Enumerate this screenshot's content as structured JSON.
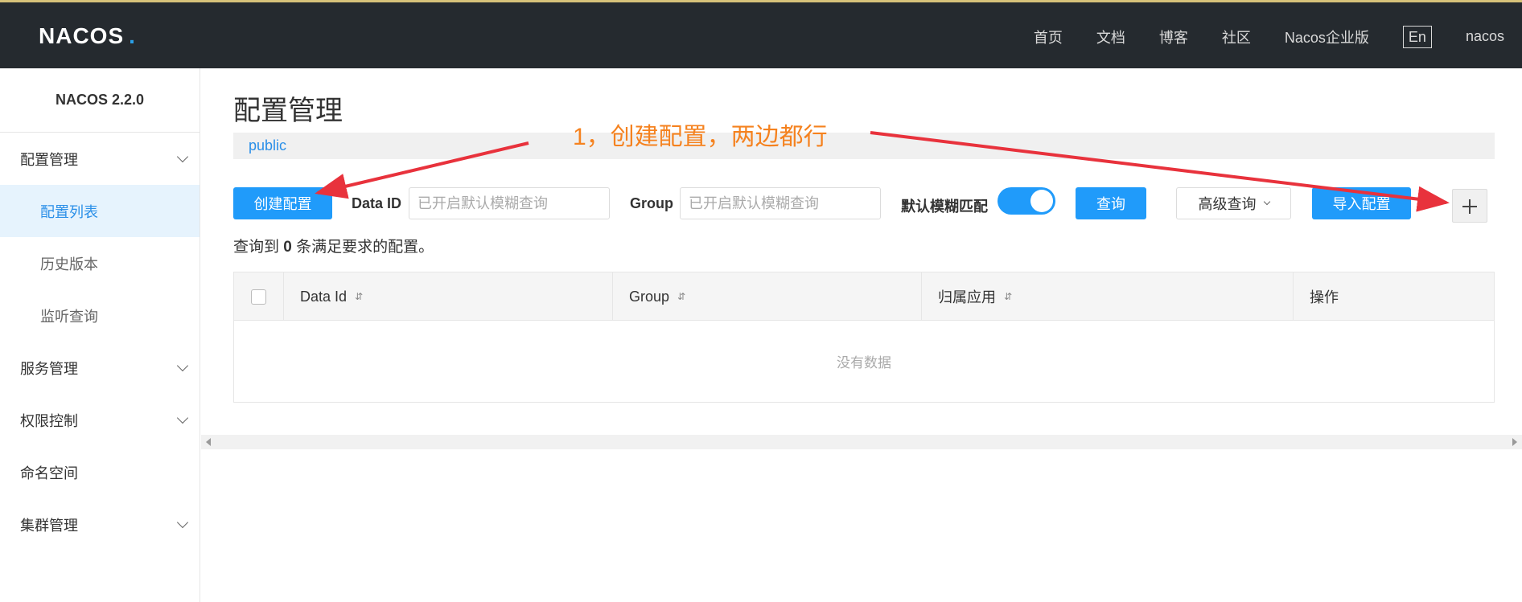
{
  "header": {
    "logo_text": "NACOS",
    "logo_dot": ".",
    "nav": [
      "首页",
      "文档",
      "博客",
      "社区",
      "Nacos企业版"
    ],
    "lang": "En",
    "user": "nacos"
  },
  "sidebar": {
    "title": "NACOS 2.2.0",
    "config_group": "配置管理",
    "config_items": [
      "配置列表",
      "历史版本",
      "监听查询"
    ],
    "service": "服务管理",
    "permission": "权限控制",
    "namespace": "命名空间",
    "cluster": "集群管理"
  },
  "main": {
    "title": "配置管理",
    "namespace": "public",
    "create_button": "创建配置",
    "dataid_label": "Data ID",
    "dataid_placeholder": "已开启默认模糊查询",
    "group_label": "Group",
    "group_placeholder": "已开启默认模糊查询",
    "fuzzy_label": "默认模糊匹配",
    "fuzzy_on": true,
    "query_button": "查询",
    "advanced_button": "高级查询",
    "import_button": "导入配置",
    "result_prefix": "查询到",
    "result_count": "0",
    "result_suffix": "条满足要求的配置。",
    "table": {
      "columns": [
        "Data Id",
        "Group",
        "归属应用",
        "操作"
      ],
      "empty": "没有数据"
    }
  },
  "annotation": {
    "text": "1，创建配置，两边都行",
    "color": "#f5821f",
    "arrow_color": "#e8323c"
  }
}
